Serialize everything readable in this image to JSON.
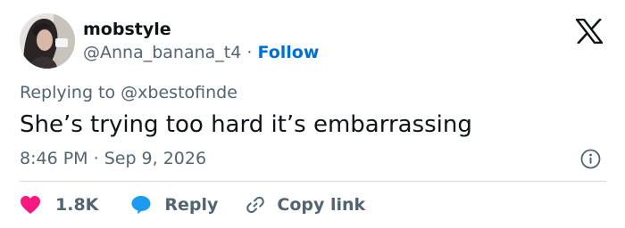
{
  "author": {
    "display_name": "mobstyle",
    "handle": "@Anna_banana_t4",
    "separator": "·",
    "follow_label": "Follow"
  },
  "reply_context": {
    "prefix": "Replying to",
    "mention": "@xbestofinde"
  },
  "tweet": {
    "text": "She’s trying too hard it’s embarrassing",
    "time": "8:46 PM",
    "separator": "·",
    "date": "Sep 9, 2026"
  },
  "actions": {
    "like_count": "1.8K",
    "reply_label": "Reply",
    "copy_link_label": "Copy link"
  },
  "icons": {
    "brand": "x-logo-icon",
    "info": "info-icon",
    "like": "heart-icon",
    "reply": "speech-bubble-icon",
    "copy": "link-icon"
  },
  "colors": {
    "text_primary": "#0f1419",
    "text_secondary": "#536471",
    "follow_blue": "#006fd6",
    "like_pink": "#f91880",
    "reply_blue": "#1d9bf0",
    "divider": "#cfd9de"
  }
}
